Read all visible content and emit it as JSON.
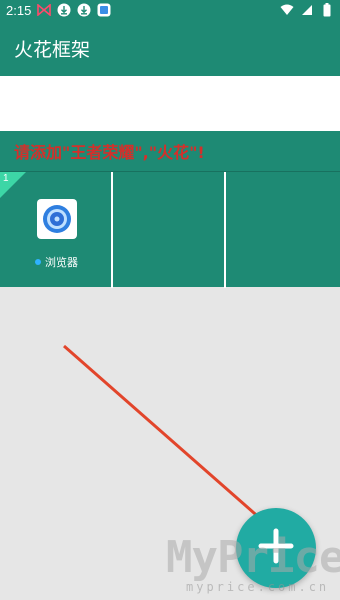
{
  "status_bar": {
    "time": "2:15",
    "left_icons": [
      "bowtie-icon",
      "download-icon",
      "download-icon",
      "gallery-icon"
    ],
    "right_icons": [
      "wifi-icon",
      "signal-icon",
      "battery-icon"
    ]
  },
  "app_bar": {
    "title": "火花框架"
  },
  "notice": {
    "text": "请添加\"王者荣耀\",\"火花\"!"
  },
  "grid": {
    "badge": "1",
    "items": [
      {
        "label": "浏览器",
        "icon": "browser-icon"
      }
    ]
  },
  "fab": {
    "icon": "plus-icon"
  },
  "watermark": {
    "main": "MyPrice",
    "sub": "myprice.com.cn"
  },
  "colors": {
    "primary": "#1e8a74",
    "notice_text": "#d3302b",
    "fab": "#21aba3",
    "arrow": "#e2452b"
  }
}
